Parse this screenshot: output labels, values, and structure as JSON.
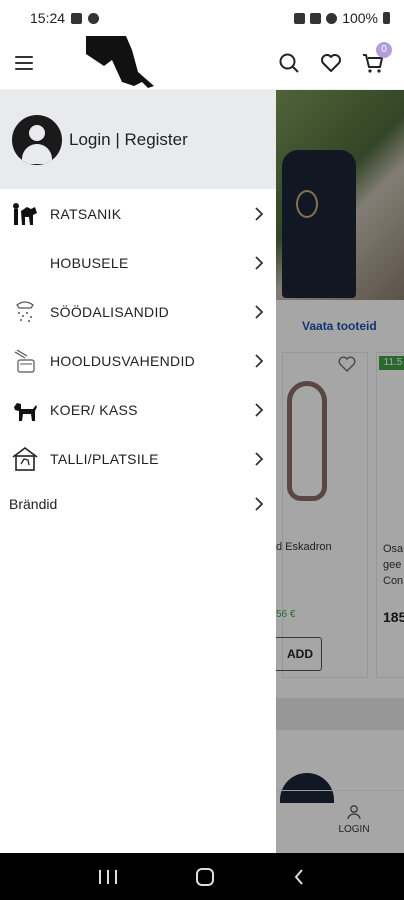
{
  "status_bar": {
    "time": "15:24",
    "battery": "100%"
  },
  "header": {
    "cart_count": "0",
    "icons": [
      "menu-icon",
      "search-icon",
      "heart-icon",
      "cart-icon"
    ]
  },
  "drawer": {
    "login_text": "Login | Register",
    "items": [
      {
        "label": "RATSANIK",
        "icon": "rider-icon"
      },
      {
        "label": "HOBUSELE",
        "icon": ""
      },
      {
        "label": "SÖÖDALISANDID",
        "icon": "feed-icon"
      },
      {
        "label": "HOOLDUSVAHENDID",
        "icon": "care-icon"
      },
      {
        "label": "KOER/ KASS",
        "icon": "dog-icon"
      },
      {
        "label": "TALLI/PLATSILE",
        "icon": "stable-icon"
      },
      {
        "label": "Brändid",
        "icon": ""
      }
    ]
  },
  "background_page": {
    "link_text": "Vaata tooteid",
    "product1_name": "d Eskadron",
    "product1_price": "56 €",
    "product2_name": "Osa\ngee\nCon",
    "product2_price": "185",
    "add_button": "ADD",
    "badge": "11.5",
    "nav_login": "LOGIN",
    "nav_partial": "T"
  },
  "colors": {
    "drawer_header_bg": "#e8eaed",
    "cart_badge": "#b39ddb",
    "link_blue": "#1f4fb0",
    "price_green": "#43a047"
  }
}
